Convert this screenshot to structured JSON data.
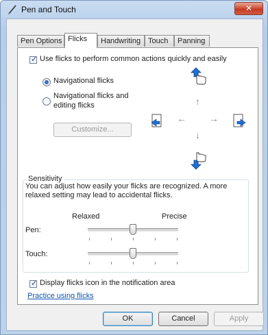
{
  "window": {
    "title": "Pen and Touch",
    "close_label": "✕"
  },
  "tabs": [
    {
      "label": "Pen Options"
    },
    {
      "label": "Flicks"
    },
    {
      "label": "Handwriting"
    },
    {
      "label": "Touch"
    },
    {
      "label": "Panning"
    }
  ],
  "flicks": {
    "use_flicks_label": "Use flicks to perform common actions quickly and easily",
    "use_flicks_checked": true,
    "nav_label": "Navigational flicks",
    "nav_edit_label_line1": "Navigational flicks and",
    "nav_edit_label_line2": "editing flicks",
    "selected_mode": "Navigational flicks",
    "customize_label": "Customize..."
  },
  "sensitivity": {
    "title": "Sensitivity",
    "description_line1": "You can adjust how easily your flicks are recognized. A more",
    "description_line2": "relaxed setting may lead to accidental flicks.",
    "relaxed_label": "Relaxed",
    "precise_label": "Precise",
    "pen_label": "Pen:",
    "touch_label": "Touch:",
    "pen_level": 0.5,
    "touch_level": 0.5
  },
  "notification": {
    "label": "Display flicks icon in the notification area",
    "checked": true,
    "practice_link": "Practice using flicks"
  },
  "footer": {
    "ok_label": "OK",
    "cancel_label": "Cancel",
    "apply_label": "Apply"
  },
  "icons": {
    "arrow_up": "↑",
    "arrow_down": "↓",
    "arrow_left": "←",
    "arrow_right": "→"
  },
  "colors": {
    "accent": "#1f6fd6",
    "link": "#0b56b0"
  }
}
